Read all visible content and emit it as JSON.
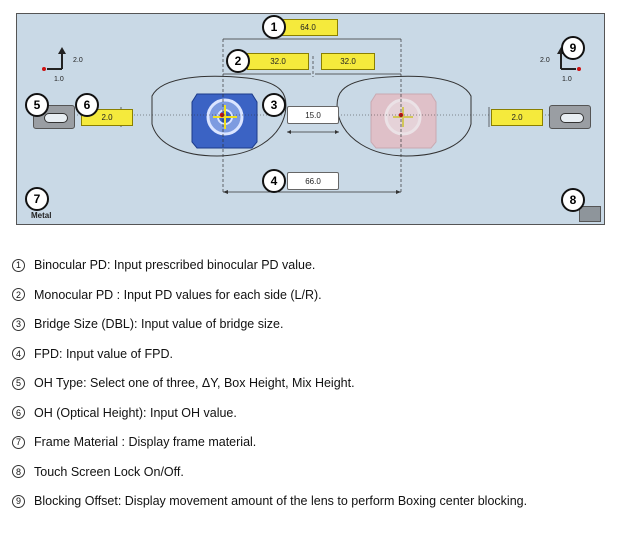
{
  "screen": {
    "binocular_pd": "64.0",
    "monocular_pd_right": "32.0",
    "monocular_pd_left": "32.0",
    "bridge_size": "15.0",
    "fpd": "66.0",
    "oh_right": "2.0",
    "oh_left": "2.0",
    "offset_right": {
      "y": "2.0",
      "x": "1.0"
    },
    "offset_left": {
      "y": "2.0",
      "x": "1.0"
    },
    "frame_material": "Metal",
    "markers": [
      "1",
      "2",
      "3",
      "4",
      "5",
      "6",
      "7",
      "8",
      "9"
    ],
    "colors": {
      "panel_bg": "#c9d9e6",
      "value_box": "#f5ea3c",
      "right_lens": "#3b63c4",
      "left_lens": "#e7b8bf",
      "marker": "#cc1111"
    }
  },
  "legend": [
    {
      "num": "1",
      "text": "Binocular PD: Input prescribed binocular PD value."
    },
    {
      "num": "2",
      "text": "Monocular PD : Input PD values for each side (L/R)."
    },
    {
      "num": "3",
      "text": "Bridge Size (DBL): Input value of bridge size."
    },
    {
      "num": "4",
      "text": "FPD: Input value of FPD."
    },
    {
      "num": "5",
      "text": "OH Type: Select one of three, ΔY, Box Height, Mix Height."
    },
    {
      "num": "6",
      "text": "OH (Optical Height): Input OH value."
    },
    {
      "num": "7",
      "text": "Frame Material : Display frame material."
    },
    {
      "num": "8",
      "text": "Touch Screen Lock On/Off."
    },
    {
      "num": "9",
      "text": "Blocking Offset: Display movement amount of the lens to perform Boxing center blocking."
    }
  ]
}
